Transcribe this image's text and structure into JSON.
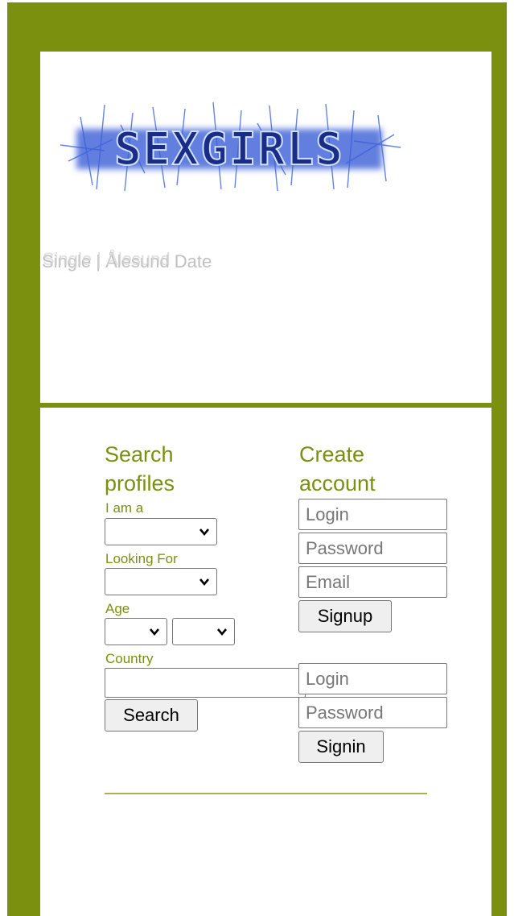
{
  "colors": {
    "frame": "#7a900e",
    "accent": "#7a900e",
    "panel": "#ffffff"
  },
  "logo": {
    "text": "SEXGIRLS",
    "glow": "#3a5fd6"
  },
  "tagline": {
    "text": "Single | Ålesund Date",
    "ghost": "Single | Ålesund"
  },
  "search": {
    "title_line1": "Search",
    "title_line2": "profiles",
    "i_am_label": "I am a",
    "looking_for_label": "Looking For",
    "age_label": "Age",
    "country_label": "Country",
    "country_value": "",
    "search_button": "Search",
    "icons": {
      "dropdown": "chevron-down-icon"
    }
  },
  "signup": {
    "title_line1": "Create",
    "title_line2": "account",
    "login_placeholder": "Login",
    "password_placeholder": "Password",
    "email_placeholder": "Email",
    "button": "Signup"
  },
  "signin": {
    "login_placeholder": "Login",
    "password_placeholder": "Password",
    "button": "Signin"
  }
}
